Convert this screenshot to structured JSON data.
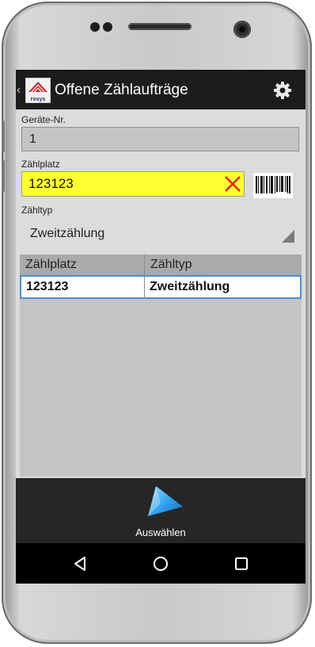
{
  "app": {
    "title": "Offene Zählaufträge",
    "logo_text": "rosys",
    "accent_color": "#4c8fd0",
    "input_highlight_color": "#ffff33"
  },
  "icons": {
    "back": "back-chevron-icon",
    "settings": "gear-icon",
    "clear": "clear-x-icon",
    "barcode": "barcode-icon",
    "action": "play-arrow-icon",
    "nav_back": "triangle-back-icon",
    "nav_home": "circle-home-icon",
    "nav_recents": "square-recents-icon"
  },
  "form": {
    "device_no": {
      "label": "Geräte-Nr.",
      "value": "1"
    },
    "count_location": {
      "label": "Zählplatz",
      "value": "123123"
    },
    "count_type": {
      "label": "Zähltyp",
      "selected": "Zweitzählung"
    }
  },
  "table": {
    "columns": [
      "Zählplatz",
      "Zähltyp"
    ],
    "rows": [
      {
        "location": "123123",
        "type": "Zweitzählung"
      }
    ]
  },
  "actions": {
    "select_label": "Auswählen"
  }
}
